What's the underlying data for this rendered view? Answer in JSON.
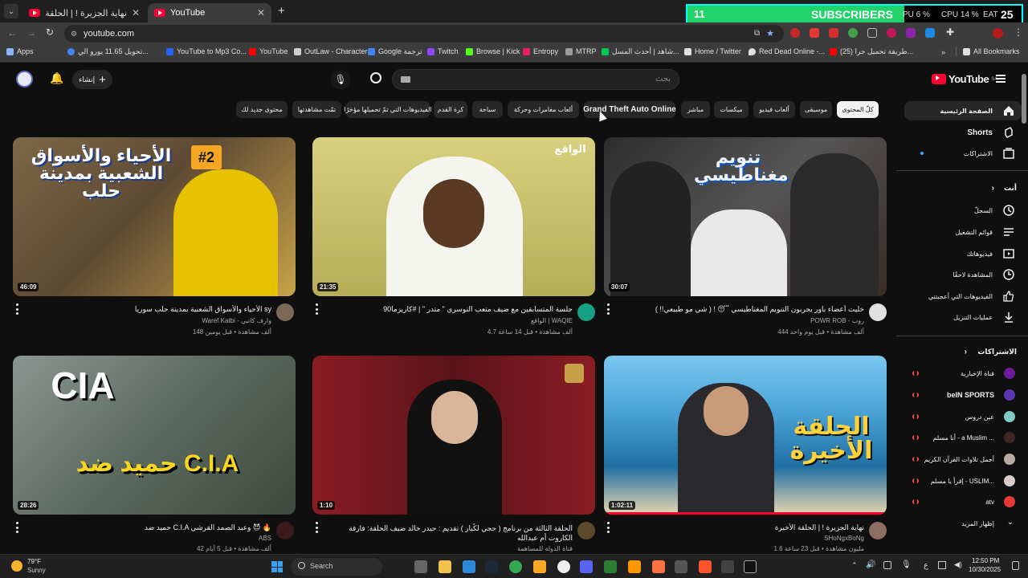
{
  "browser": {
    "tabs": [
      {
        "title": "نهاية الجزيرة ! | الحلقة الأخيرة - ..."
      },
      {
        "title": "YouTube"
      }
    ],
    "new_tab_label": "+",
    "url": "youtube.com",
    "bookmarks": [
      {
        "label": "Apps",
        "color": "#8ab4f8"
      },
      {
        "label": "تحويل 11.65 يورو الي...",
        "color": "#4285f4"
      },
      {
        "label": "YouTube to Mp3 Co...",
        "color": "#2962ff"
      },
      {
        "label": "YouTube",
        "color": "#ff0000"
      },
      {
        "label": "OutLaw - Character",
        "color": "#d0d0d0"
      },
      {
        "label": "Google ترجمة",
        "color": "#4285f4"
      },
      {
        "label": "Twitch",
        "color": "#9146ff"
      },
      {
        "label": "Browse | Kick",
        "color": "#53fc18"
      },
      {
        "label": "Entropy",
        "color": "#e91e63"
      },
      {
        "label": "MTRP",
        "color": "#9e9e9e"
      },
      {
        "label": "شاهد | أحدث المسل...",
        "color": "#00c853"
      },
      {
        "label": "Home / Twitter",
        "color": "#e0e0e0"
      },
      {
        "label": "Red Dead Online -...",
        "color": "#e0e0e0"
      },
      {
        "label": "(25) طريقة تحميل جرا...",
        "color": "#ff0000"
      },
      {
        "label": "All Bookmarks",
        "color": "#e0e0e0"
      }
    ]
  },
  "overlay": {
    "count": "11",
    "label": "SUBSCRIBERS",
    "goal": "25",
    "gpu": "PU 6 %",
    "cpu": "CPU 14 %",
    "eat": "EAT"
  },
  "youtube": {
    "logo_text": "YouTube",
    "region": "SA",
    "create_label": "إنشاء",
    "search_placeholder": "بحث",
    "chips": [
      {
        "label": "كلّ المحتوى",
        "active": true
      },
      {
        "label": "موسيقى"
      },
      {
        "label": "ألعاب فيديو"
      },
      {
        "label": "ميكسات"
      },
      {
        "label": "مباشر"
      },
      {
        "label": "Grand Theft Auto Online"
      },
      {
        "label": "ألعاب مغامرات وحركة"
      },
      {
        "label": "سباحة"
      },
      {
        "label": "كرة القدم"
      },
      {
        "label": "الفيديوهات التي تمّ تحميلها مؤخرًا"
      },
      {
        "label": "تمّت مشاهدتها"
      },
      {
        "label": "محتوى جديد لك"
      }
    ],
    "sidebar": {
      "main": [
        {
          "label": "الصفحة الرئيسية"
        },
        {
          "label": "Shorts"
        },
        {
          "label": "الاشتراكات"
        }
      ],
      "you_header": "أنت",
      "you": [
        {
          "label": "السجلّ"
        },
        {
          "label": "قوائم التشغيل"
        },
        {
          "label": "فيديوهاتك"
        },
        {
          "label": "المشاهدة لاحقًا"
        },
        {
          "label": "الفيديوهات التي أعجبتني"
        },
        {
          "label": "عمليات التنزيل"
        }
      ],
      "subs_header": "الاشتراكات",
      "subs": [
        {
          "label": "قناة الإخبارية",
          "color": "#6a1b9a"
        },
        {
          "label": "beIN SPORTS",
          "color": "#5e35b1"
        },
        {
          "label": "عين دروس",
          "color": "#80cbc4"
        },
        {
          "label": "أنا مسلم - a Muslim ...",
          "color": "#3e2723"
        },
        {
          "label": "أجمل تلاوات القرآن الكريم",
          "color": "#bcaaa4"
        },
        {
          "label": "إقرأ يا مسلم - USLIM...",
          "color": "#d7ccc8"
        },
        {
          "label": "atv",
          "color": "#e53935"
        }
      ],
      "show_more": "إظهار المزيد"
    },
    "videos": [
      {
        "title": "الأحياء والأسواق الشعبية بمدينة حلب سوريا sy",
        "channel": "Waref Katbi - وارف كاتبي",
        "meta": "148 ألف مشاهدة • قبل يومين",
        "duration": "46:09",
        "thumb_text": "الأحياء والأسواق الشعبية بمدينة حلب",
        "thumb_badge": "#2",
        "bg": "#6d5a3a"
      },
      {
        "title": "جلسة المتسابقين مع ضيف متعب النوسري \" متدر \" | #كاريزما90",
        "channel": "الواقع | WAQIE",
        "meta": "4.7 ألف مشاهدة • قبل 14 ساعة",
        "duration": "21:35",
        "thumb_text": "الواقع",
        "thumb_badge": "",
        "bg": "#c9c27a"
      },
      {
        "title": "خليت أعضاء باور يجربون التنويم المغناطيسي 😴 ! ( شي مو طبيعي!! )",
        "channel": "POWR ROB - روب",
        "meta": "444 ألف مشاهدة • قبل يوم واحد",
        "duration": "30:07",
        "thumb_text": "تنويم مغناطيسي",
        "thumb_badge": "",
        "bg": "#3a3a3a"
      },
      {
        "title": "حميد ضد C.I.A وعبد الصمد القرشي 😈 🔥",
        "channel": "ABS",
        "meta": "42 ألف مشاهدة • قبل 5 أيام",
        "duration": "28:26",
        "thumb_text": "حميد ضد C.I.A",
        "thumb_badge": "CIA",
        "bg": "#5b6a60"
      },
      {
        "title": "الحلقة الثالثة من برنامج ( حجي لكُبار ) تقديم : حيدر خالد ضيف الحلقة: فارقة الكاروت أم عبدالله",
        "channel": "قناة الدولة للمساهمة",
        "meta": "",
        "duration": "1:10",
        "thumb_text": "",
        "thumb_badge": "",
        "bg": "#7a1e22"
      },
      {
        "title": "نهاية الجزيرة ! | الحلقة الأخيرة",
        "channel": "SHoNgxBoNg",
        "meta": "1.6 مليون مشاهدة • قبل 23 ساعة",
        "duration": "1:02:11",
        "thumb_text": "الحلقة الأخيرة",
        "thumb_badge": "",
        "bg": "#2f8bb7"
      }
    ]
  },
  "taskbar": {
    "weather_temp": "79°F",
    "weather_text": "Sunny",
    "search_label": "Search",
    "time": "12:50 PM",
    "date": "10/30/2025",
    "lang": "ع"
  }
}
